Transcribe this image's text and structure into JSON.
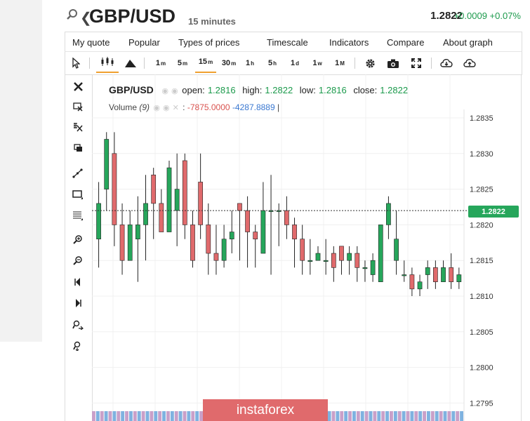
{
  "header": {
    "symbol": "GBP/USD",
    "timeframe": "15 minutes",
    "price": "1.2822",
    "change": "+0.0009 +0.07%"
  },
  "menu": {
    "items": [
      "My quote",
      "Popular",
      "Types of prices",
      "Timescale",
      "Indicators",
      "Compare",
      "About graph"
    ]
  },
  "toolbar": {
    "timeframes": [
      {
        "main": "1",
        "sup": "m"
      },
      {
        "main": "5",
        "sup": "m"
      },
      {
        "main": "15",
        "sup": "m"
      },
      {
        "main": "30",
        "sup": "m"
      },
      {
        "main": "1",
        "sup": "h"
      },
      {
        "main": "5",
        "sup": "h"
      },
      {
        "main": "1",
        "sup": "d"
      },
      {
        "main": "1",
        "sup": "w"
      },
      {
        "main": "1",
        "sup": "M"
      }
    ],
    "active_timeframe": "15m"
  },
  "legend": {
    "symbol": "GBP/USD",
    "open_label": "open:",
    "open": "1.2816",
    "high_label": "high:",
    "high": "1.2822",
    "low_label": "low:",
    "low": "1.2816",
    "close_label": "close:",
    "close": "1.2822",
    "volume_label": "Volume",
    "volume_param": "(9)",
    "volume_sep": ":",
    "volume_neg": "-7875.0000",
    "volume_pos": "-4287.8889",
    "volume_end": "|"
  },
  "current_price_label": "1.2822",
  "watermark": "instaforex",
  "colors": {
    "up": "#26a65b",
    "down": "#e06a6c",
    "accent": "#f0a030"
  },
  "chart_data": {
    "type": "candlestick",
    "y_ticks": [
      "1.2835",
      "1.2830",
      "1.2825",
      "1.2820",
      "1.2815",
      "1.2810",
      "1.2805",
      "1.2800",
      "1.2795"
    ],
    "ylim": [
      1.2793,
      1.2839
    ],
    "last_price": 1.2822,
    "candles": [
      {
        "o": 1.2818,
        "h": 1.2826,
        "l": 1.2814,
        "c": 1.2823
      },
      {
        "o": 1.2825,
        "h": 1.2833,
        "l": 1.2822,
        "c": 1.2832
      },
      {
        "o": 1.283,
        "h": 1.2833,
        "l": 1.2817,
        "c": 1.282
      },
      {
        "o": 1.282,
        "h": 1.2823,
        "l": 1.2813,
        "c": 1.2815
      },
      {
        "o": 1.2815,
        "h": 1.2822,
        "l": 1.2815,
        "c": 1.282
      },
      {
        "o": 1.2818,
        "h": 1.2824,
        "l": 1.2812,
        "c": 1.282
      },
      {
        "o": 1.282,
        "h": 1.2827,
        "l": 1.2815,
        "c": 1.2823
      },
      {
        "o": 1.2827,
        "h": 1.2828,
        "l": 1.2818,
        "c": 1.2823
      },
      {
        "o": 1.2823,
        "h": 1.2825,
        "l": 1.2819,
        "c": 1.2819
      },
      {
        "o": 1.2819,
        "h": 1.2829,
        "l": 1.2819,
        "c": 1.2828
      },
      {
        "o": 1.2822,
        "h": 1.283,
        "l": 1.2817,
        "c": 1.2825
      },
      {
        "o": 1.2829,
        "h": 1.283,
        "l": 1.2818,
        "c": 1.282
      },
      {
        "o": 1.282,
        "h": 1.2822,
        "l": 1.2814,
        "c": 1.2815
      },
      {
        "o": 1.2826,
        "h": 1.283,
        "l": 1.2818,
        "c": 1.282
      },
      {
        "o": 1.282,
        "h": 1.2823,
        "l": 1.2813,
        "c": 1.2816
      },
      {
        "o": 1.2816,
        "h": 1.282,
        "l": 1.2813,
        "c": 1.2815
      },
      {
        "o": 1.2815,
        "h": 1.282,
        "l": 1.2814,
        "c": 1.2818
      },
      {
        "o": 1.2818,
        "h": 1.2822,
        "l": 1.2816,
        "c": 1.2819
      },
      {
        "o": 1.2823,
        "h": 1.2823,
        "l": 1.2815,
        "c": 1.2822
      },
      {
        "o": 1.2822,
        "h": 1.2824,
        "l": 1.2814,
        "c": 1.2819
      },
      {
        "o": 1.2819,
        "h": 1.282,
        "l": 1.2814,
        "c": 1.2818
      },
      {
        "o": 1.2816,
        "h": 1.2826,
        "l": 1.2816,
        "c": 1.2822
      },
      {
        "o": 1.2822,
        "h": 1.2827,
        "l": 1.2813,
        "c": 1.2822
      },
      {
        "o": 1.2822,
        "h": 1.2823,
        "l": 1.2817,
        "c": 1.2822
      },
      {
        "o": 1.2822,
        "h": 1.2824,
        "l": 1.2818,
        "c": 1.282
      },
      {
        "o": 1.282,
        "h": 1.2821,
        "l": 1.2814,
        "c": 1.2818
      },
      {
        "o": 1.2818,
        "h": 1.282,
        "l": 1.2813,
        "c": 1.2815
      },
      {
        "o": 1.2815,
        "h": 1.2818,
        "l": 1.2813,
        "c": 1.2815
      },
      {
        "o": 1.2815,
        "h": 1.2817,
        "l": 1.2815,
        "c": 1.2816
      },
      {
        "o": 1.2815,
        "h": 1.2818,
        "l": 1.2813,
        "c": 1.2815
      },
      {
        "o": 1.2816,
        "h": 1.2817,
        "l": 1.2812,
        "c": 1.2814
      },
      {
        "o": 1.2817,
        "h": 1.2817,
        "l": 1.2813,
        "c": 1.2815
      },
      {
        "o": 1.2815,
        "h": 1.2817,
        "l": 1.2813,
        "c": 1.2816
      },
      {
        "o": 1.2816,
        "h": 1.2817,
        "l": 1.2812,
        "c": 1.2814
      },
      {
        "o": 1.2814,
        "h": 1.2815,
        "l": 1.2812,
        "c": 1.2814
      },
      {
        "o": 1.2813,
        "h": 1.2816,
        "l": 1.2812,
        "c": 1.2815
      },
      {
        "o": 1.2812,
        "h": 1.282,
        "l": 1.2812,
        "c": 1.282
      },
      {
        "o": 1.282,
        "h": 1.2824,
        "l": 1.2818,
        "c": 1.2823
      },
      {
        "o": 1.2815,
        "h": 1.2822,
        "l": 1.2813,
        "c": 1.2818
      },
      {
        "o": 1.2813,
        "h": 1.2815,
        "l": 1.2812,
        "c": 1.2813
      },
      {
        "o": 1.2813,
        "h": 1.2814,
        "l": 1.281,
        "c": 1.2811
      },
      {
        "o": 1.2811,
        "h": 1.2813,
        "l": 1.281,
        "c": 1.2812
      },
      {
        "o": 1.2813,
        "h": 1.2815,
        "l": 1.2811,
        "c": 1.2814
      },
      {
        "o": 1.2814,
        "h": 1.2815,
        "l": 1.2811,
        "c": 1.2812
      },
      {
        "o": 1.2812,
        "h": 1.2815,
        "l": 1.2812,
        "c": 1.2814
      },
      {
        "o": 1.2814,
        "h": 1.2816,
        "l": 1.2811,
        "c": 1.2812
      },
      {
        "o": 1.2812,
        "h": 1.2814,
        "l": 1.2811,
        "c": 1.2813
      }
    ]
  }
}
